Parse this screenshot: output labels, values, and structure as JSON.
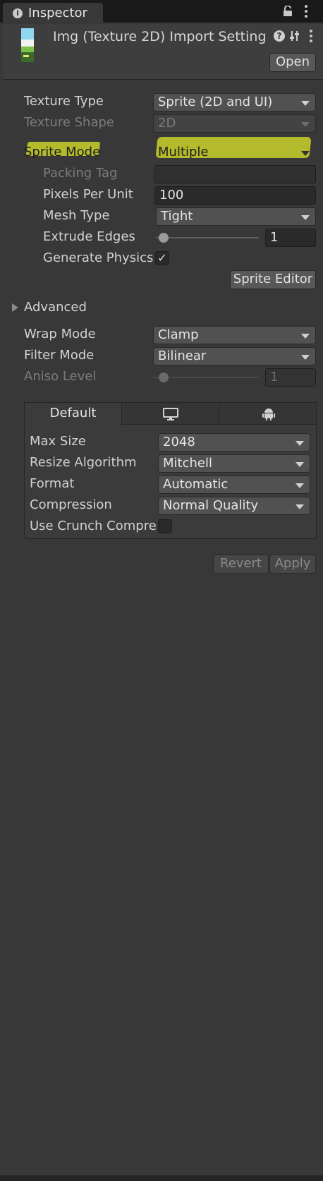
{
  "tab": {
    "title": "Inspector"
  },
  "header": {
    "title": "Img (Texture 2D) Import Setting",
    "open_button": "Open"
  },
  "settings": {
    "texture_type": {
      "label": "Texture Type",
      "value": "Sprite (2D and UI)"
    },
    "texture_shape": {
      "label": "Texture Shape",
      "value": "2D"
    },
    "sprite_mode": {
      "label": "Sprite Mode",
      "value": "Multiple"
    },
    "packing_tag": {
      "label": "Packing Tag",
      "value": ""
    },
    "pixels_per_unit": {
      "label": "Pixels Per Unit",
      "value": "100"
    },
    "mesh_type": {
      "label": "Mesh Type",
      "value": "Tight"
    },
    "extrude_edges": {
      "label": "Extrude Edges",
      "value": "1",
      "fraction": 0.03
    },
    "generate_physics": {
      "label": "Generate Physics",
      "checked": true
    },
    "sprite_editor_button": "Sprite Editor",
    "advanced": "Advanced",
    "wrap_mode": {
      "label": "Wrap Mode",
      "value": "Clamp"
    },
    "filter_mode": {
      "label": "Filter Mode",
      "value": "Bilinear"
    },
    "aniso_level": {
      "label": "Aniso Level",
      "value": "1",
      "fraction": 0.03
    }
  },
  "platform": {
    "tabs": [
      {
        "label": "Default",
        "icon": ""
      },
      {
        "label": "",
        "icon": "monitor-icon"
      },
      {
        "label": "",
        "icon": "android-icon"
      }
    ],
    "max_size": {
      "label": "Max Size",
      "value": "2048"
    },
    "resize_algorithm": {
      "label": "Resize Algorithm",
      "value": "Mitchell"
    },
    "format": {
      "label": "Format",
      "value": "Automatic"
    },
    "compression": {
      "label": "Compression",
      "value": "Normal Quality"
    },
    "use_crunch": {
      "label": "Use Crunch Compre",
      "checked": false
    }
  },
  "footer": {
    "revert": "Revert",
    "apply": "Apply"
  },
  "colors": {
    "highlight": "#c9d12a",
    "background": "#383838"
  }
}
